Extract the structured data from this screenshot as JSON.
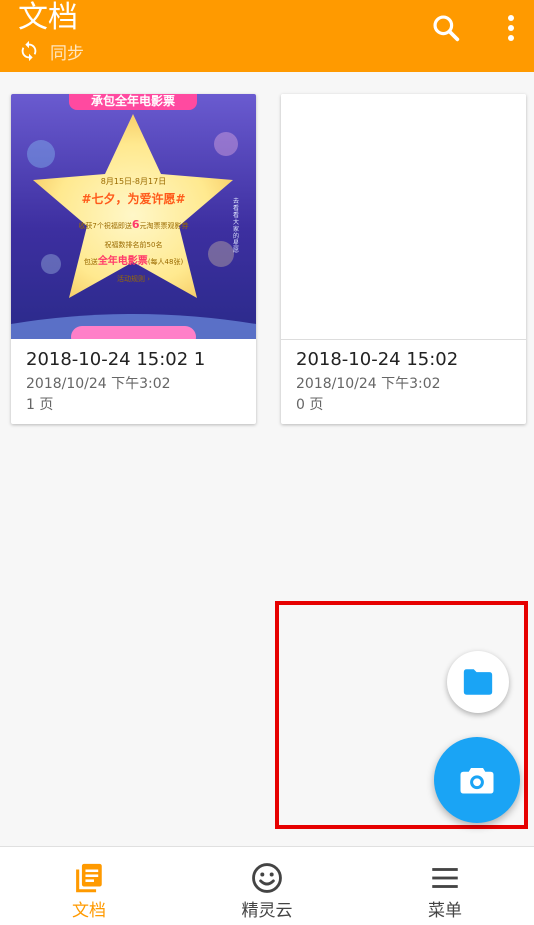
{
  "appbar": {
    "title": "文档",
    "sync_label": "同步",
    "background": "#ff9a00"
  },
  "documents": [
    {
      "name": "2018-10-24 15:02 1",
      "date": "2018/10/24 下午3:02",
      "pages": "1 页",
      "thumbnail": "poster",
      "poster": {
        "banner": "承包全年电影票",
        "dates": "8月15日-8月17日",
        "headline": "#七夕，为爱许愿#",
        "line1": "收获7个祝福即送",
        "line1_highlight": "6",
        "line1_tail": "元淘票票观影券",
        "line2": "祝福数排名前50名",
        "line3_prefix": "包送",
        "line3_highlight": "全年电影票",
        "line3_tail": "(每人48张)",
        "rules": "活动规则 ›",
        "side_text": "去看看大家的星愿"
      }
    },
    {
      "name": "2018-10-24 15:02",
      "date": "2018/10/24 下午3:02",
      "pages": "0 页",
      "thumbnail": "blank"
    }
  ],
  "fab": {
    "folder_icon": "folder-icon",
    "camera_icon": "camera-icon",
    "camera_color": "#1aa4f5",
    "highlight_color": "#e60000"
  },
  "bottom_nav": [
    {
      "label": "文档",
      "icon": "documents-icon",
      "active": true,
      "color": "#ff9a00"
    },
    {
      "label": "精灵云",
      "icon": "smiley-icon",
      "active": false,
      "color": "#444444"
    },
    {
      "label": "菜单",
      "icon": "menu-icon",
      "active": false,
      "color": "#444444"
    }
  ]
}
